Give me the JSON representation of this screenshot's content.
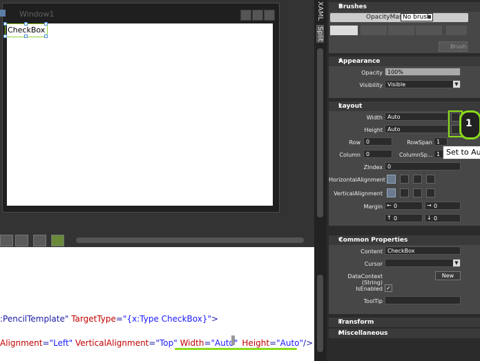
{
  "design": {
    "window_title": "Window1",
    "checkbox_label": "CheckBox"
  },
  "side_tabs": {
    "xaml": "XAML",
    "split": "Split"
  },
  "xaml": {
    "line1_prefix": ":PencilTemplate\"",
    "line1_attr": " TargetType",
    "line1_eq": "=",
    "line1_val": "\"{x:Type CheckBox}\"",
    "line1_end": ">",
    "line2_a": "Alignment",
    "line2_b": "=",
    "line2_c": "\"Left\"",
    "line2_d": " VerticalAlignment",
    "line2_e": "=",
    "line2_f": "\"Top\"",
    "line2_g": " Width",
    "line2_h": "=",
    "line2_i": "\"Auto\"",
    "line2_j": "Height",
    "line2_k": "=",
    "line2_l": "\"Auto\"",
    "line2_m": "/>"
  },
  "brushes": {
    "header": "Brushes",
    "opacity_mask": "OpacityMask",
    "no_brush": "No brush",
    "brush_button": "Brush"
  },
  "appearance": {
    "header": "Appearance",
    "opacity_label": "Opacity",
    "opacity_value": "100%",
    "visibility_label": "Visibility",
    "visibility_value": "Visible"
  },
  "layout": {
    "header": "Layout",
    "width_label": "Width",
    "width_value": "Auto",
    "height_label": "Height",
    "height_value": "Auto",
    "row_label": "Row",
    "row_value": "0",
    "rowspan_label": "RowSpan",
    "rowspan_value": "1",
    "column_label": "Column",
    "column_value": "0",
    "columnspan_label": "ColumnSp...",
    "columnspan_value": "1",
    "zindex_label": "ZIndex",
    "zindex_value": "0",
    "halign_label": "HorizontalAlignment",
    "valign_label": "VerticalAlignment",
    "margin_label": "Margin",
    "margin_left": "0",
    "margin_right": "0",
    "margin_top": "0",
    "margin_bottom": "0",
    "tooltip": "Set to Au",
    "callout": "1"
  },
  "common": {
    "header": "Common Properties",
    "content_label": "Content",
    "content_value": "CheckBox",
    "cursor_label": "Cursor",
    "datacontext_label": "DataContext",
    "datacontext_type": "(String)",
    "new_button": "New",
    "isenabled_label": "IsEnabled",
    "isenabled_check": "✓",
    "tooltip_label": "ToolTip"
  },
  "transform": {
    "header": "Transform"
  },
  "misc": {
    "header": "Miscellaneous"
  },
  "colors": {
    "accent_green": "#8cdc1a"
  }
}
